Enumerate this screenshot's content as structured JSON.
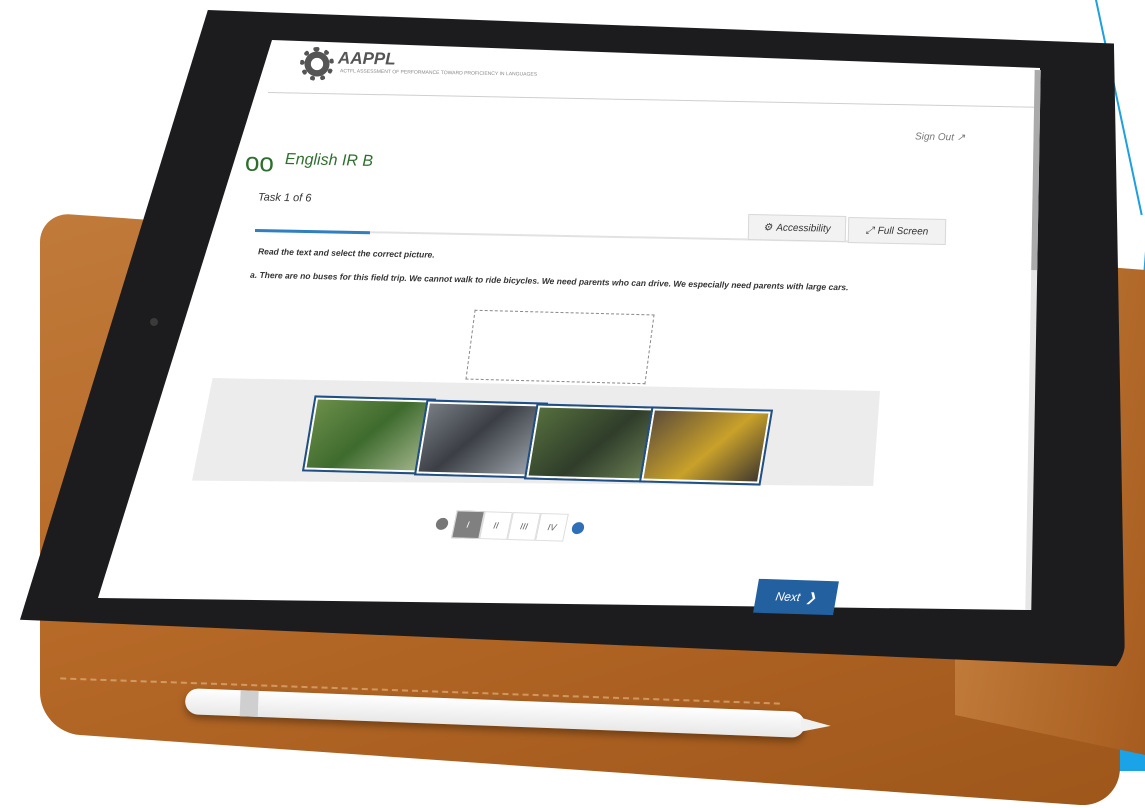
{
  "header": {
    "logo_text": "AAPPL",
    "logo_subtitle": "ACTFL ASSESSMENT OF PERFORMANCE TOWARD PROFICIENCY IN LANGUAGES",
    "sign_out_label": "Sign Out"
  },
  "test": {
    "title": "English IR B",
    "task_label": "Task 1 of 6",
    "progress_fraction": 0.17
  },
  "toolbar": {
    "accessibility_label": "Accessibility",
    "fullscreen_label": "Full Screen"
  },
  "question": {
    "instruction": "Read the text and select the correct picture.",
    "prompt": "a. There are no buses for this field trip. We cannot walk to ride bicycles. We need parents who can drive. We especially need parents with large cars."
  },
  "choices": [
    {
      "icon": "photo-children-walking"
    },
    {
      "icon": "photo-family-car"
    },
    {
      "icon": "photo-children-bicycles"
    },
    {
      "icon": "photo-school-bus"
    }
  ],
  "pager": {
    "items": [
      "I",
      "II",
      "III",
      "IV"
    ],
    "active_index": 0
  },
  "footer": {
    "next_label": "Next"
  },
  "colors": {
    "brand_blue": "#23609f",
    "title_green": "#2e6f2e",
    "accent_cyan": "#1aa3e6"
  }
}
